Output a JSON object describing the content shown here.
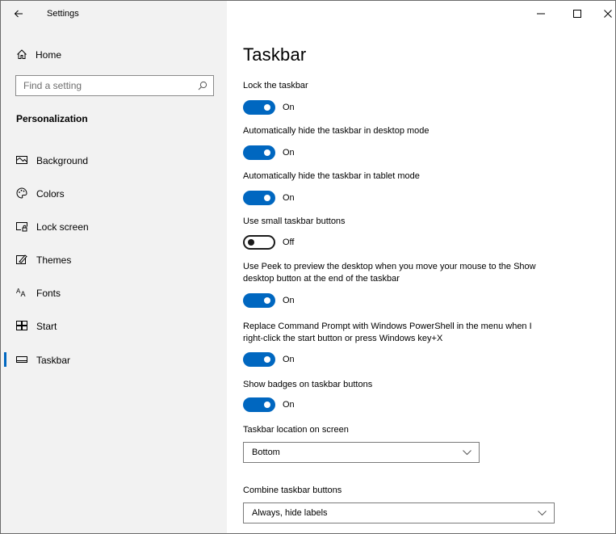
{
  "window": {
    "app_title": "Settings",
    "controls": {
      "minimize": "minimize-icon",
      "maximize": "maximize-icon",
      "close": "close-icon"
    }
  },
  "sidebar": {
    "home_label": "Home",
    "search": {
      "placeholder": "Find a setting",
      "value": ""
    },
    "section_title": "Personalization",
    "items": [
      {
        "label": "Background",
        "icon": "picture-icon",
        "selected": false
      },
      {
        "label": "Colors",
        "icon": "palette-icon",
        "selected": false
      },
      {
        "label": "Lock screen",
        "icon": "lock-screen-icon",
        "selected": false
      },
      {
        "label": "Themes",
        "icon": "themes-icon",
        "selected": false
      },
      {
        "label": "Fonts",
        "icon": "fonts-icon",
        "selected": false
      },
      {
        "label": "Start",
        "icon": "start-icon",
        "selected": false
      },
      {
        "label": "Taskbar",
        "icon": "taskbar-icon",
        "selected": true
      }
    ]
  },
  "main": {
    "title": "Taskbar",
    "settings": [
      {
        "label": "Lock the taskbar",
        "state": "On"
      },
      {
        "label": "Automatically hide the taskbar in desktop mode",
        "state": "On"
      },
      {
        "label": "Automatically hide the taskbar in tablet mode",
        "state": "On"
      },
      {
        "label": "Use small taskbar buttons",
        "state": "Off"
      },
      {
        "label": "Use Peek to preview the desktop when you move your mouse to the Show desktop button at the end of the taskbar",
        "state": "On"
      },
      {
        "label": "Replace Command Prompt with Windows PowerShell in the menu when I right-click the start button or press Windows key+X",
        "state": "On"
      },
      {
        "label": "Show badges on taskbar buttons",
        "state": "On"
      }
    ],
    "location": {
      "label": "Taskbar location on screen",
      "value": "Bottom"
    },
    "combine": {
      "label": "Combine taskbar buttons",
      "value": "Always, hide labels"
    }
  },
  "colors": {
    "accent": "#0067c0",
    "sidebar_bg": "#f2f2f2",
    "main_bg": "#ffffff"
  }
}
